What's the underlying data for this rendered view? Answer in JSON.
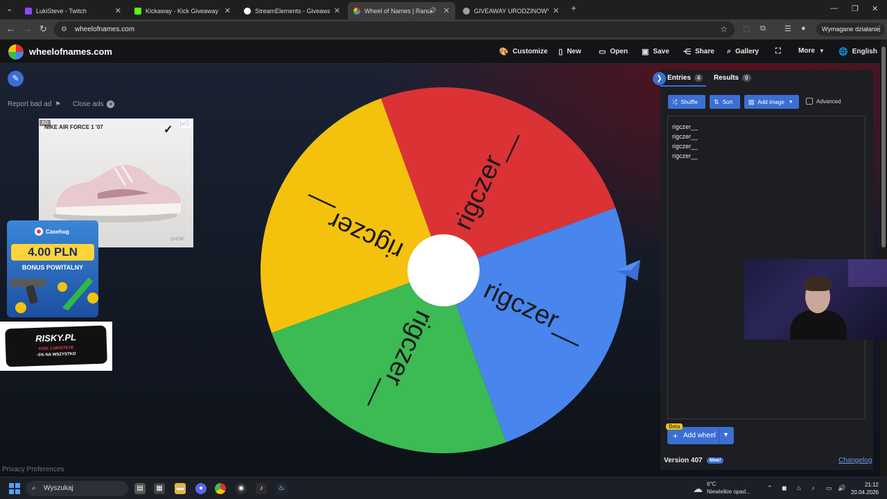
{
  "browser": {
    "tabs": [
      {
        "title": "LukiSteve - Twitch",
        "favicon_color": "#9146ff",
        "active": false
      },
      {
        "title": "Kickaway - Kick Giveaway Tool",
        "favicon_color": "#53fc18",
        "active": false
      },
      {
        "title": "StreamElements - Giveaways",
        "favicon_color": "#ffffff",
        "active": false
      },
      {
        "title": "Wheel of Names | Random",
        "favicon_color": "#db3236",
        "active": true
      },
      {
        "title": "GIVEAWAY URODZINOWY",
        "favicon_color": "#9aa0a6",
        "active": false
      }
    ],
    "url": "wheelofnames.com",
    "action_label": "Wymagane działanie"
  },
  "site": {
    "name": "wheelofnames.com",
    "menu": [
      {
        "label": "Customize",
        "icon": "palette-icon"
      },
      {
        "label": "New",
        "icon": "file-icon"
      },
      {
        "label": "Open",
        "icon": "folder-icon"
      },
      {
        "label": "Save",
        "icon": "floppy-icon"
      },
      {
        "label": "Share",
        "icon": "share-icon"
      },
      {
        "label": "Gallery",
        "icon": "search-icon"
      },
      {
        "label": "",
        "icon": "fullscreen-icon"
      },
      {
        "label": "More",
        "icon": "caret-down-icon"
      },
      {
        "label": "English",
        "icon": "globe-icon"
      }
    ]
  },
  "ads": {
    "report_label": "Report bad ad",
    "close_label": "Close ads",
    "nike": {
      "tag": "AD",
      "title": "NIKE AIR FORCE 1 '07",
      "shop": "SHOP"
    },
    "casehug": {
      "brand": "Casehug",
      "amount": "4.00 PLN",
      "bonus": "BONUS POWITALNY"
    },
    "risky": {
      "name": "RISKY.PL",
      "code": "KOD: LUKISTEVE",
      "offer": "-5% NA WSZYSTKO"
    },
    "privacy": "Privacy Preferences"
  },
  "wheel": {
    "segments": [
      {
        "label": "rigczer__",
        "color": "#db3236"
      },
      {
        "label": "rigczer__",
        "color": "#4885ed"
      },
      {
        "label": "rigczer__",
        "color": "#3cba54"
      },
      {
        "label": "rigczer__",
        "color": "#f4c20d"
      }
    ],
    "pointer_color": "#3b6fd4"
  },
  "panel": {
    "tabs": [
      {
        "label": "Entries",
        "count": "4"
      },
      {
        "label": "Results",
        "count": "0"
      }
    ],
    "buttons": {
      "shuffle": "Shuffle",
      "sort": "Sort",
      "add_image": "Add image"
    },
    "advanced_label": "Advanced",
    "entries": [
      "rigczer__",
      "rigczer__",
      "rigczer__",
      "rigczer__"
    ],
    "beta_label": "Beta",
    "add_wheel_label": "Add wheel",
    "version_label": "Version 407",
    "new_badge": "New!",
    "changelog_label": "Changelog"
  },
  "taskbar": {
    "search_placeholder": "Wyszukaj",
    "weather_temp": "6°C",
    "weather_desc": "Niewielkie opad...",
    "time": "21:12",
    "date": "20.04.2026"
  }
}
